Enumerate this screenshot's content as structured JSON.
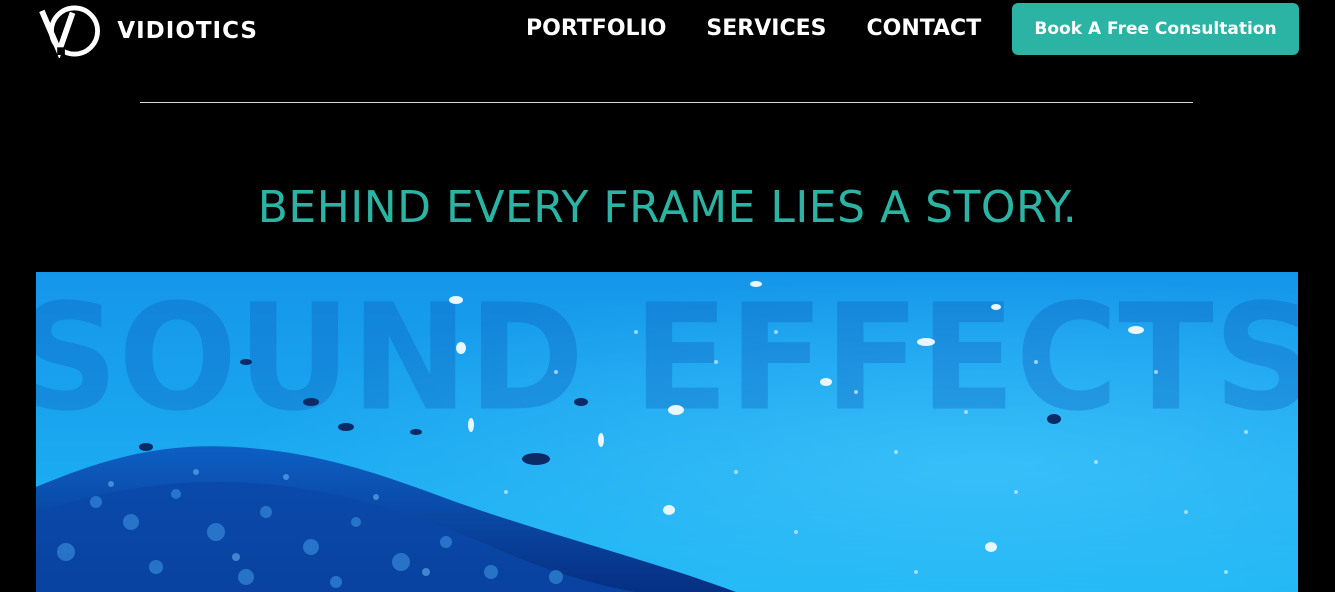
{
  "brand": {
    "name": "VIDIOTICS",
    "logo_icon": "vd-monogram-logo"
  },
  "nav": {
    "items": [
      {
        "label": "PORTFOLIO"
      },
      {
        "label": "SERVICES"
      },
      {
        "label": "CONTACT"
      }
    ],
    "cta_label": "Book A Free Consultation"
  },
  "hero": {
    "headline": "BEHIND EVERY FRAME LIES A STORY.",
    "video_overlay_text": "SOUND EFFECTS",
    "video_subject": "underwater coral reef with fish"
  },
  "colors": {
    "background": "#000000",
    "accent": "#2bb3a3",
    "text": "#ffffff",
    "divider": "#d9d9d9",
    "water_light": "#1aa8f0",
    "water_deep": "#0a4fb8"
  }
}
